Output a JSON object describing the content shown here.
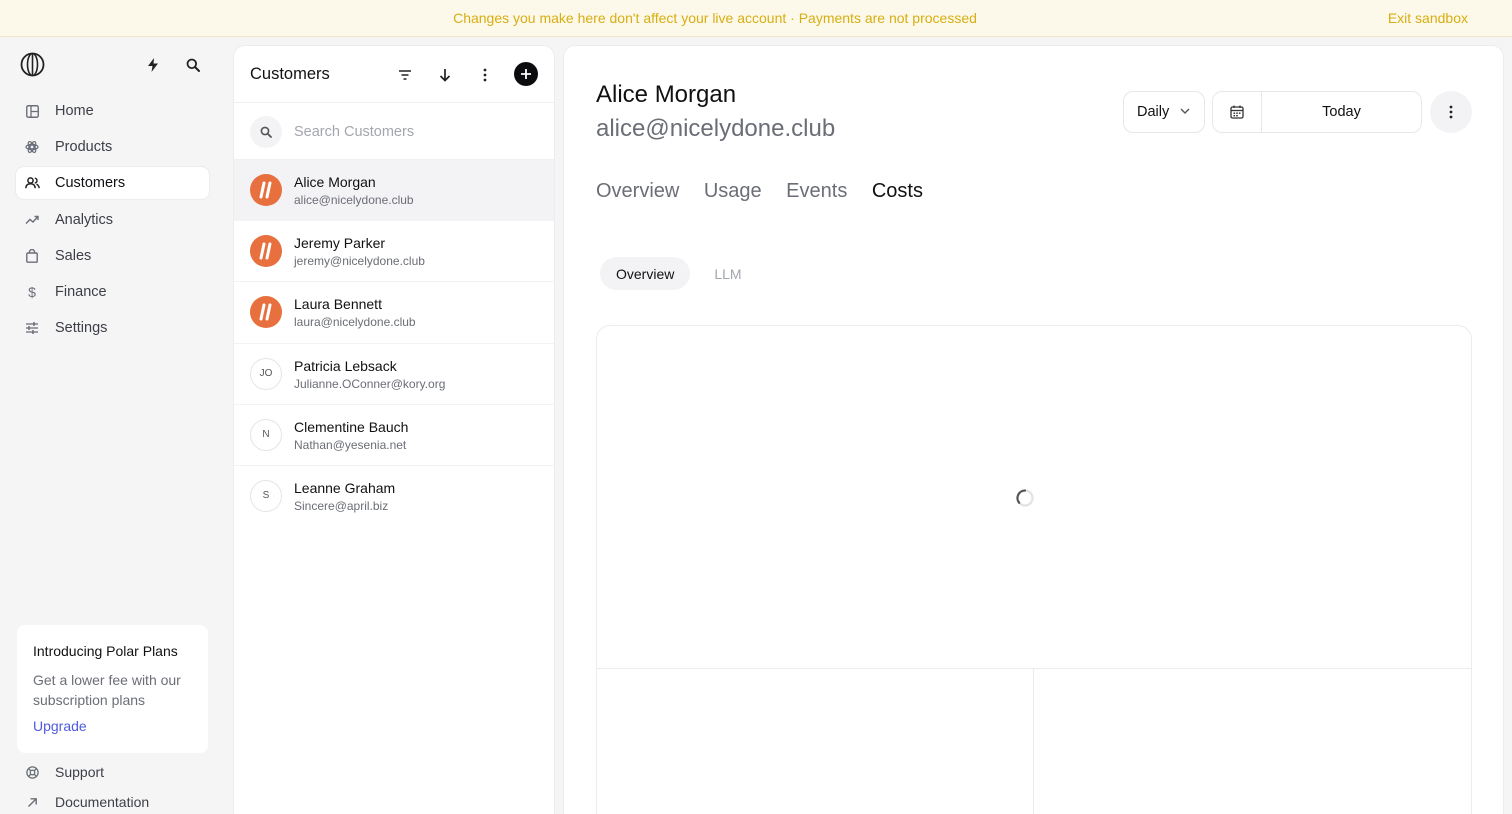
{
  "banner": {
    "message": "Changes you make here don't affect your live account · Payments are not processed",
    "exit_label": "Exit sandbox"
  },
  "sidebar": {
    "items": [
      {
        "label": "Home",
        "icon": "home-icon"
      },
      {
        "label": "Products",
        "icon": "products-icon"
      },
      {
        "label": "Customers",
        "icon": "customers-icon",
        "active": true
      },
      {
        "label": "Analytics",
        "icon": "analytics-icon"
      },
      {
        "label": "Sales",
        "icon": "sales-icon"
      },
      {
        "label": "Finance",
        "icon": "finance-icon"
      },
      {
        "label": "Settings",
        "icon": "settings-icon"
      }
    ],
    "promo": {
      "title": "Introducing Polar Plans",
      "text": "Get a lower fee with our subscription plans",
      "link": "Upgrade"
    },
    "footer": {
      "support": "Support",
      "documentation": "Documentation"
    }
  },
  "customers_panel": {
    "title": "Customers",
    "search_placeholder": "Search Customers",
    "customers": [
      {
        "name": "Alice Morgan",
        "email": "alice@nicelydone.club",
        "avatar": "logo",
        "active": true
      },
      {
        "name": "Jeremy Parker",
        "email": "jeremy@nicelydone.club",
        "avatar": "logo"
      },
      {
        "name": "Laura Bennett",
        "email": "laura@nicelydone.club",
        "avatar": "logo"
      },
      {
        "name": "Patricia Lebsack",
        "email": "Julianne.OConner@kory.org",
        "avatar": "JO"
      },
      {
        "name": "Clementine Bauch",
        "email": "Nathan@yesenia.net",
        "avatar": "N"
      },
      {
        "name": "Leanne Graham",
        "email": "Sincere@april.biz",
        "avatar": "S"
      }
    ]
  },
  "detail": {
    "name": "Alice Morgan",
    "email": "alice@nicelydone.club",
    "period": "Daily",
    "date_label": "Today",
    "tabs": [
      "Overview",
      "Usage",
      "Events",
      "Costs"
    ],
    "active_tab": "Costs",
    "subtabs": [
      "Overview",
      "LLM"
    ],
    "active_subtab": "Overview"
  },
  "colors": {
    "banner_bg": "#fcf9ea",
    "banner_text": "#d8ae12",
    "avatar_brand": "#e8703f",
    "link": "#4f5ae0"
  }
}
